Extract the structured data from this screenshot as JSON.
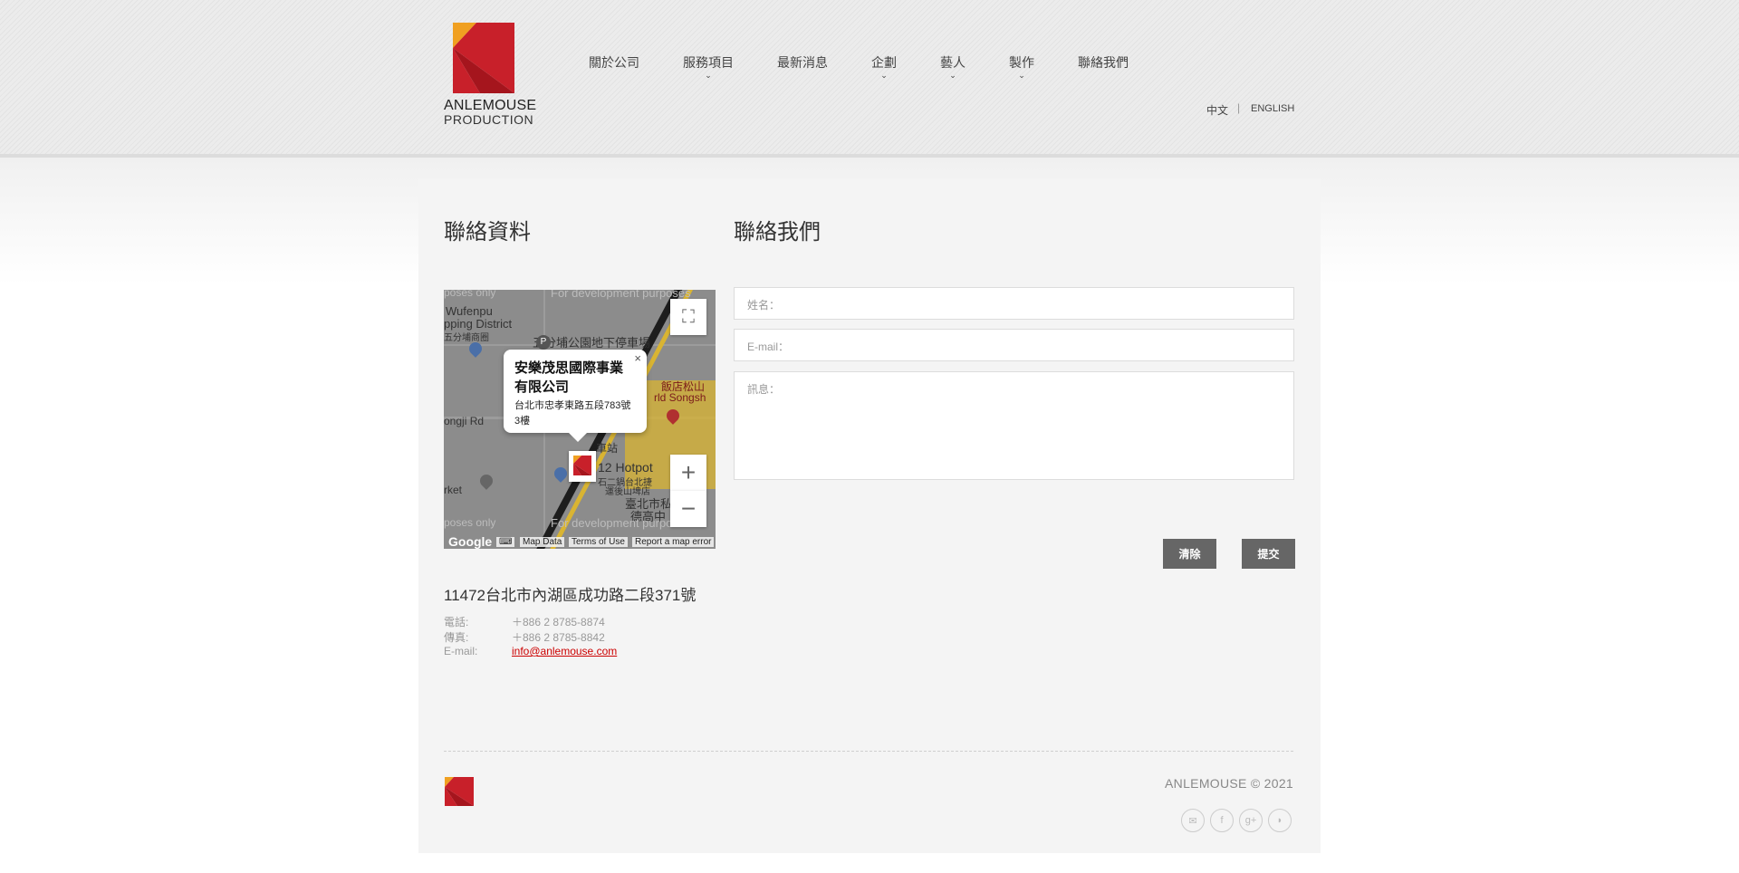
{
  "brand": {
    "name_line1": "ANLEMOUSE",
    "name_line2": "PRODUCTION",
    "colors": {
      "red": "#c8202a",
      "orange": "#f0a021"
    }
  },
  "nav": {
    "items": [
      {
        "label": "關於公司",
        "has_dropdown": false
      },
      {
        "label": "服務項目",
        "has_dropdown": true
      },
      {
        "label": "最新消息",
        "has_dropdown": false
      },
      {
        "label": "企劃",
        "has_dropdown": true
      },
      {
        "label": "藝人",
        "has_dropdown": true
      },
      {
        "label": "製作",
        "has_dropdown": true
      },
      {
        "label": "聯絡我們",
        "has_dropdown": false
      }
    ],
    "caret": "⌄"
  },
  "language": {
    "zh": "中文",
    "separator": "|",
    "en": "ENGLISH"
  },
  "contact_info": {
    "title": "聯絡資料",
    "address": "11472台北市內湖區成功路二段371號",
    "phone_label": "電話:",
    "phone_value": "＋886 2 8785-8874",
    "fax_label": "傳真:",
    "fax_value": "＋886 2 8785-8842",
    "email_label": "E-mail:",
    "email_value": "info@anlemouse.com"
  },
  "map": {
    "infowindow_title": "安樂茂思國際事業有限公司",
    "infowindow_address": "台北市忠孝東路五段783號3樓",
    "close": "×",
    "labels": {
      "dev1": "poses only",
      "dev2": "For development purposes",
      "dev3": "poses only",
      "dev4": "For development purposes",
      "wufenpu": "Wufenpu",
      "district": "pping District",
      "wufenpu_cn": "五分埔商圈",
      "parking": "五分埔公園地下停車場",
      "hotel": "飯店松山",
      "songshan": "rld Songsh",
      "yongji": "ongji Rd",
      "station": "車站",
      "hotpot": "12 Hotpot",
      "hotpot_cn": "石二鍋台北捷",
      "hotpot_cn2": "運後山埤店",
      "market": "rket",
      "taipei": "臺北市私",
      "taipei2": "德高中"
    },
    "footer": {
      "google": "Google",
      "map_data": "Map Data",
      "terms": "Terms of Use",
      "report": "Report a map error"
    },
    "zoom_in": "+",
    "zoom_out": "−",
    "fullscreen": "⛶"
  },
  "form": {
    "title": "聯絡我們",
    "name_label": "姓名：",
    "email_label": "E-mail：",
    "message_label": "訊息：",
    "clear_button": "清除",
    "submit_button": "提交"
  },
  "footer": {
    "copyright": "ANLEMOUSE © 2021",
    "social": [
      "mail-icon",
      "facebook-icon",
      "google-plus-icon",
      "rss-icon"
    ],
    "social_glyphs": [
      "✉",
      "f",
      "g+",
      "◗"
    ]
  }
}
